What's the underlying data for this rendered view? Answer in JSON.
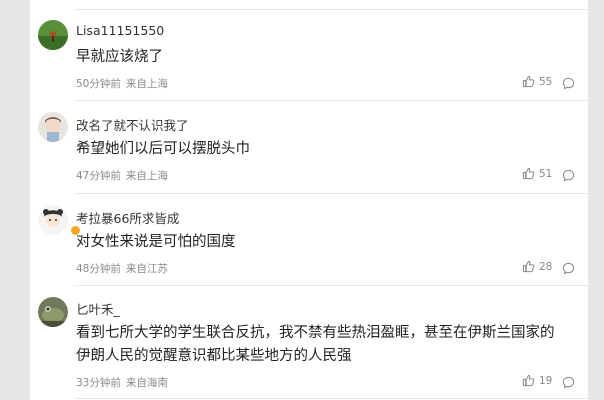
{
  "comments": [
    {
      "username": "Lisa11151550",
      "text": "早就应该烧了",
      "time": "50分钟前",
      "location": "来自上海",
      "likes": "55",
      "avatar_icon": "green-field-avatar"
    },
    {
      "username": "改名了就不认识我了",
      "text": "希望她们以后可以摆脱头巾",
      "time": "47分钟前",
      "location": "来自上海",
      "likes": "51",
      "avatar_icon": "girl-avatar"
    },
    {
      "username": "考拉暴66所求皆成",
      "text": "对女性来说是可怕的国度",
      "time": "48分钟前",
      "location": "来自江苏",
      "likes": "28",
      "avatar_icon": "cartoon-girl-avatar",
      "verified": true
    },
    {
      "username": "匕叶禾_",
      "text_lines": [
        "看到七所大学的学生联合反抗，我不禁有些热泪盈眶，甚至在伊斯兰国家的",
        "伊朗人民的觉醒意识都比某些地方的人民强"
      ],
      "time": "33分钟前",
      "location": "来自海南",
      "likes": "19",
      "avatar_icon": "frog-avatar"
    }
  ],
  "colors": {
    "background": "#e6e6e6",
    "panel": "#ffffff",
    "text": "#222222",
    "meta": "#8a8a8a",
    "verified_badge": "#f5a623"
  }
}
